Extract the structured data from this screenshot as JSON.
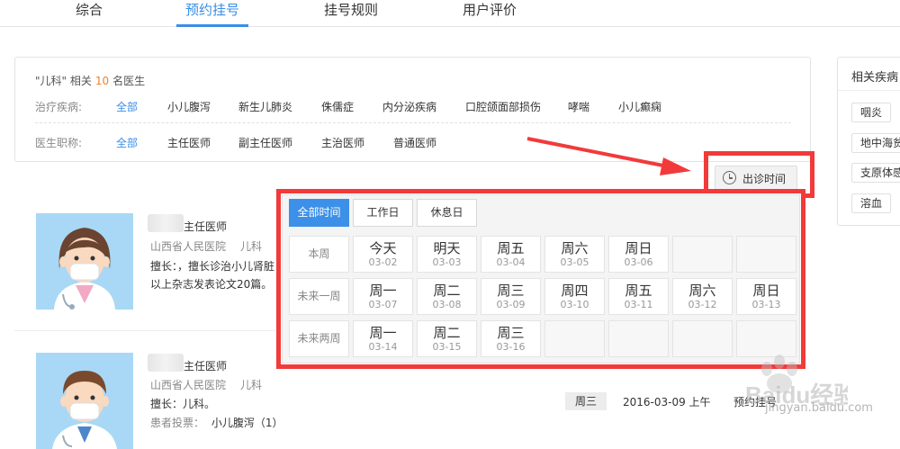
{
  "tabs": [
    {
      "label": "综合",
      "active": false
    },
    {
      "label": "预约挂号",
      "active": true
    },
    {
      "label": "挂号规则",
      "active": false
    },
    {
      "label": "用户评价",
      "active": false
    }
  ],
  "filter": {
    "summary_prefix": "\"儿科\" 相关",
    "summary_count": "10",
    "summary_suffix": "名医生",
    "disease_label": "治疗疾病:",
    "disease_options": [
      "全部",
      "小儿腹泻",
      "新生儿肺炎",
      "侏儒症",
      "内分泌疾病",
      "口腔颌面部损伤",
      "哮喘",
      "小儿癫痫"
    ],
    "title_label": "医生职称:",
    "title_options": [
      "全部",
      "主任医师",
      "副主任医师",
      "主治医师",
      "普通医师"
    ]
  },
  "side_panel": {
    "title": "相关疾病",
    "tags": [
      "咽炎",
      "地中海贫",
      "支原体感",
      "溶血"
    ]
  },
  "time_button": {
    "label": "出诊时间",
    "icon": "clock-icon"
  },
  "doctors": [
    {
      "title": "主任医师",
      "hospital": "山西省人民医院",
      "dept": "儿科",
      "line1": "擅长：，擅长诊治小儿肾脏",
      "line2": "以上杂志发表论文20篇。"
    },
    {
      "title": "主任医师",
      "hospital": "山西省人民医院",
      "dept": "儿科",
      "line1": "擅长：儿科。",
      "line2_label": "患者投票：",
      "line2_value": "小儿腹泻（1）"
    }
  ],
  "schedule_row": {
    "day": "周三",
    "date": "2016-03-09 上午",
    "action": "预约挂号"
  },
  "popup": {
    "tabs": [
      {
        "label": "全部时间",
        "active": true
      },
      {
        "label": "工作日",
        "active": false
      },
      {
        "label": "休息日",
        "active": false
      }
    ],
    "rows": [
      {
        "label": "本周",
        "days": [
          {
            "wk": "今天",
            "dt": "03-02"
          },
          {
            "wk": "明天",
            "dt": "03-03"
          },
          {
            "wk": "周五",
            "dt": "03-04"
          },
          {
            "wk": "周六",
            "dt": "03-05"
          },
          {
            "wk": "周日",
            "dt": "03-06"
          },
          {
            "wk": "",
            "dt": ""
          },
          {
            "wk": "",
            "dt": ""
          }
        ]
      },
      {
        "label": "未来一周",
        "days": [
          {
            "wk": "周一",
            "dt": "03-07"
          },
          {
            "wk": "周二",
            "dt": "03-08"
          },
          {
            "wk": "周三",
            "dt": "03-09"
          },
          {
            "wk": "周四",
            "dt": "03-10"
          },
          {
            "wk": "周五",
            "dt": "03-11"
          },
          {
            "wk": "周六",
            "dt": "03-12"
          },
          {
            "wk": "周日",
            "dt": "03-13"
          }
        ]
      },
      {
        "label": "未来两周",
        "days": [
          {
            "wk": "周一",
            "dt": "03-14"
          },
          {
            "wk": "周二",
            "dt": "03-15"
          },
          {
            "wk": "周三",
            "dt": "03-16"
          },
          {
            "wk": "",
            "dt": ""
          },
          {
            "wk": "",
            "dt": ""
          },
          {
            "wk": "",
            "dt": ""
          },
          {
            "wk": "",
            "dt": ""
          }
        ]
      }
    ]
  },
  "watermark": {
    "logo": "Baidu经验",
    "url": "jingyan.baidu.com"
  },
  "colors": {
    "accent": "#3a8ee6",
    "highlight": "#f23a3a",
    "count": "#f0812b"
  }
}
